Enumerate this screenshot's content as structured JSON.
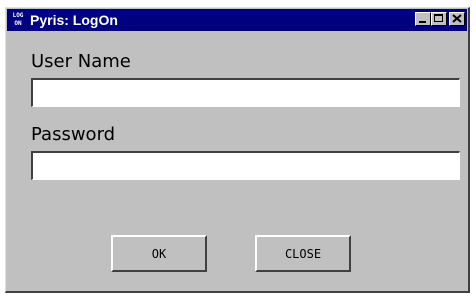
{
  "window": {
    "title": "Pyris: LogOn",
    "icon": {
      "name": "logon-app-icon",
      "line1": "LOG",
      "line2": "ON"
    },
    "controls": [
      "minimize-icon",
      "maximize-icon",
      "close-icon"
    ]
  },
  "form": {
    "user_name": {
      "label": "User Name",
      "value": "",
      "placeholder": ""
    },
    "password": {
      "label": "Password",
      "value": "",
      "placeholder": ""
    }
  },
  "buttons": {
    "ok_label": "OK",
    "close_label": "CLOSE"
  },
  "colors": {
    "titlebar": "#000080",
    "window_face": "#c0c0c0",
    "field_bg": "#ffffff"
  }
}
